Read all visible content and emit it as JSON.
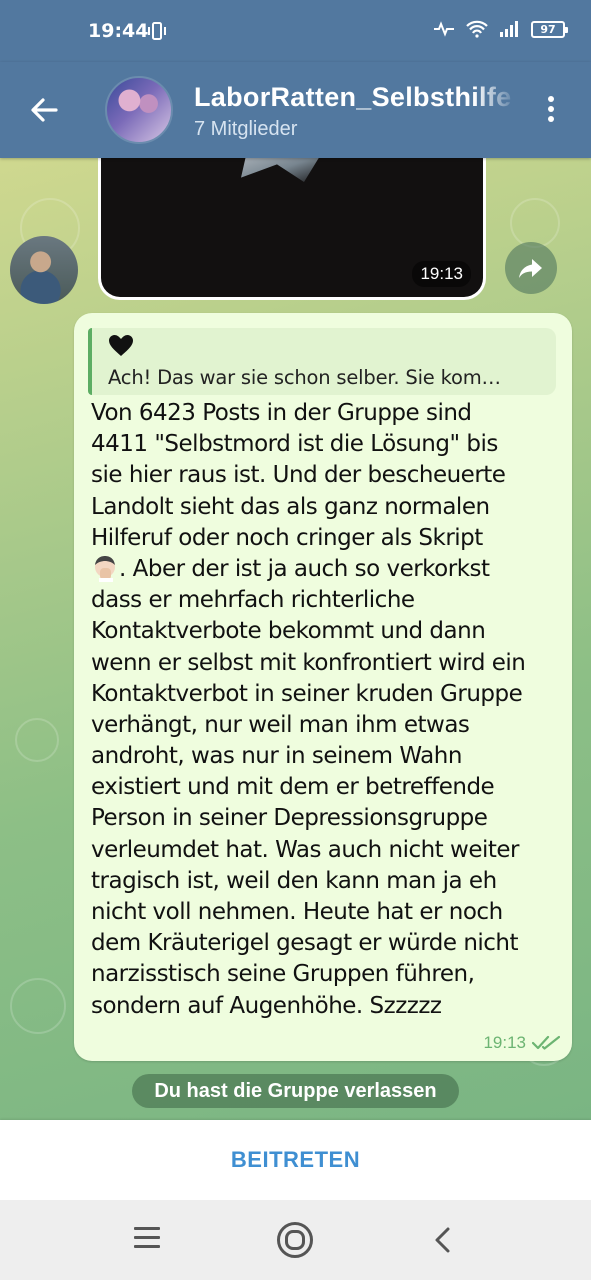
{
  "status_bar": {
    "time": "19:44",
    "battery": "97"
  },
  "header": {
    "title": "LaborRatten_Selbsthilfe",
    "subtitle": "7 Mitglieder"
  },
  "video_message": {
    "time": "19:13"
  },
  "message": {
    "reply_preview": "Ach! Das war sie schon selber. Sie kom…",
    "lines": [
      "Von 6423 Posts in der Gruppe sind",
      "4411 \"Selbstmord ist die Lösung\" bis",
      "sie hier raus ist. Und der bescheuerte",
      "Landolt sieht das als ganz normalen",
      "Hilferuf oder noch cringer als Skript",
      ". Aber der ist ja auch so verkorkst",
      "dass er mehrfach richterliche",
      "Kontaktverbote bekommt und dann",
      "wenn er selbst mit konfrontiert wird ein",
      "Kontaktverbot in seiner kruden Gruppe",
      "verhängt, nur weil man ihm etwas",
      "androht, was nur in seinem Wahn",
      "existiert und mit dem er betreffende",
      "Person in seiner Depressionsgruppe",
      "verleumdet hat. Was auch nicht weiter",
      "tragisch ist, weil den kann man ja eh",
      "nicht voll nehmen. Heute hat er noch",
      "dem Kräuterigel gesagt er würde nicht",
      "narzisstisch seine Gruppen führen,",
      "sondern auf Augenhöhe. Szzzzz"
    ],
    "time": "19:13"
  },
  "system_message": "Du hast die Gruppe verlassen",
  "join_button": "BEITRETEN",
  "colors": {
    "header": "#52789f",
    "bubble": "#effdde",
    "accent": "#3f8fd2",
    "check": "#6cb472"
  }
}
